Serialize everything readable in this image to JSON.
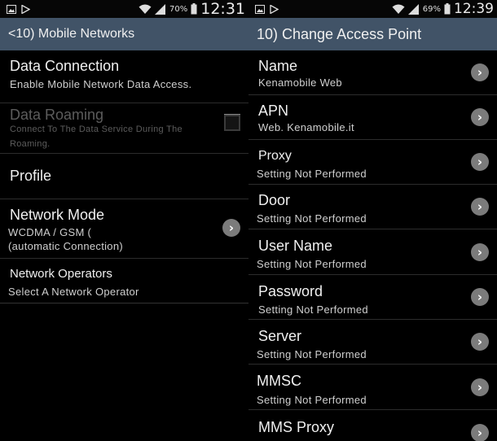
{
  "left_screen": {
    "status": {
      "battery_pct": "70%",
      "time": "12:31"
    },
    "title": "<10) Mobile Networks",
    "rows": [
      {
        "title": "Data Connection",
        "subtitle": "Enable Mobile Network Data Access."
      },
      {
        "title": "Data Roaming",
        "subtitle_line1": "Connect To The Data Service During The",
        "subtitle_line2": "Roaming."
      },
      {
        "title": "Profile"
      },
      {
        "title": "Network Mode",
        "subtitle_line1": "WCDMA / GSM (",
        "subtitle_line2": "(automatic Connection)"
      },
      {
        "title": "Network Operators",
        "subtitle": "Select A Network Operator"
      }
    ]
  },
  "right_screen": {
    "status": {
      "battery_pct": "69%",
      "time": "12:39"
    },
    "title": "10) Change Access Point",
    "rows": [
      {
        "title": "Name",
        "subtitle": "Kenamobile Web"
      },
      {
        "title": "APN",
        "subtitle": "Web. Kenamobile.it"
      },
      {
        "title": "Proxy",
        "subtitle": "Setting Not Performed"
      },
      {
        "title": "Door",
        "subtitle": "Setting Not Performed"
      },
      {
        "title": "User Name",
        "subtitle": "Setting Not Performed"
      },
      {
        "title": "Password",
        "subtitle": "Setting Not Performed"
      },
      {
        "title": "Server",
        "subtitle": "Setting Not Performed"
      },
      {
        "title": "MMSC",
        "subtitle": "Setting Not Performed"
      },
      {
        "title": "MMS Proxy"
      }
    ]
  },
  "icons": {
    "notification_icons": [
      "gallery-icon",
      "play-store-icon"
    ],
    "status_icons": [
      "wifi-icon",
      "signal-icon",
      "battery-icon"
    ],
    "row_action": "chevron-right-icon"
  },
  "colors": {
    "title_bar": "#415367",
    "background": "#000000",
    "disabled_text": "#5c5c5c"
  }
}
